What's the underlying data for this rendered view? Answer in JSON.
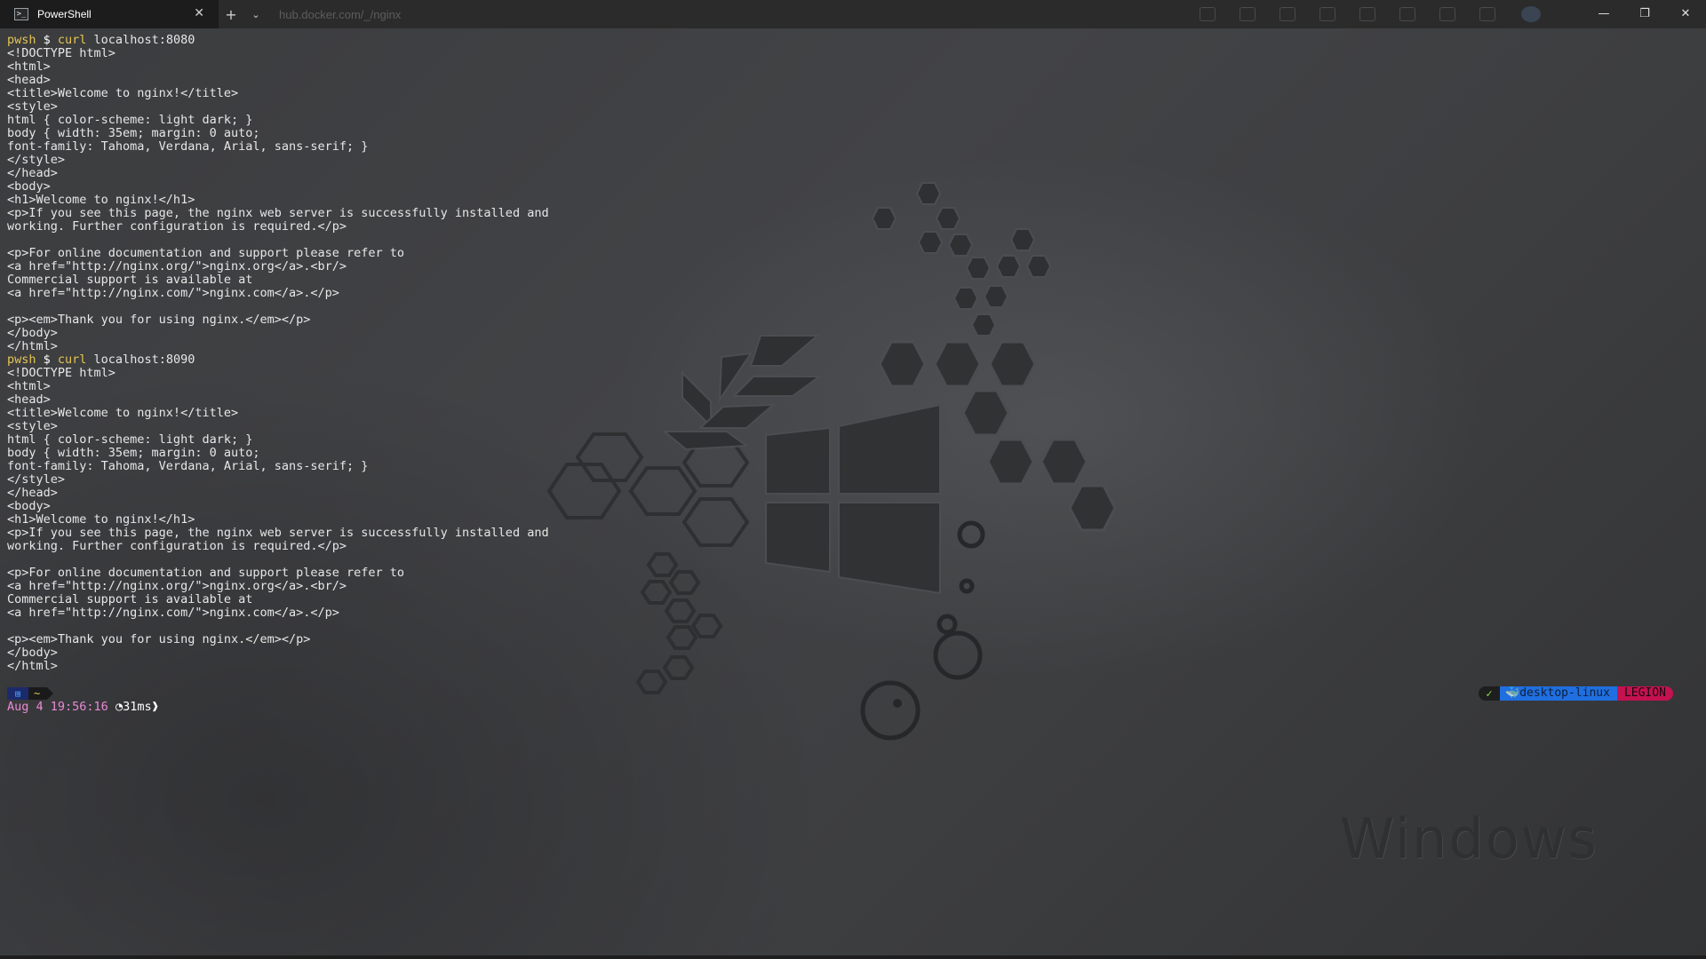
{
  "titlebar": {
    "tab_title": "PowerShell",
    "tab_icon_glyph": ">_",
    "close_glyph": "✕",
    "new_tab_glyph": "+",
    "dropdown_glyph": "⌄",
    "ghost_url": "hub.docker.com/_/nginx",
    "minimize_glyph": "—",
    "maximize_glyph": "❐",
    "window_close_glyph": "✕"
  },
  "terminal": {
    "lines": [
      {
        "type": "prompt",
        "user": "pwsh",
        "dollar": " $ ",
        "cmd": "curl",
        "args": " localhost:8080"
      },
      {
        "type": "text",
        "text": "<!DOCTYPE html>"
      },
      {
        "type": "text",
        "text": "<html>"
      },
      {
        "type": "text",
        "text": "<head>"
      },
      {
        "type": "text",
        "text": "<title>Welcome to nginx!</title>"
      },
      {
        "type": "text",
        "text": "<style>"
      },
      {
        "type": "text",
        "text": "html { color-scheme: light dark; }"
      },
      {
        "type": "text",
        "text": "body { width: 35em; margin: 0 auto;"
      },
      {
        "type": "text",
        "text": "font-family: Tahoma, Verdana, Arial, sans-serif; }"
      },
      {
        "type": "text",
        "text": "</style>"
      },
      {
        "type": "text",
        "text": "</head>"
      },
      {
        "type": "text",
        "text": "<body>"
      },
      {
        "type": "text",
        "text": "<h1>Welcome to nginx!</h1>"
      },
      {
        "type": "text",
        "text": "<p>If you see this page, the nginx web server is successfully installed and"
      },
      {
        "type": "text",
        "text": "working. Further configuration is required.</p>"
      },
      {
        "type": "text",
        "text": ""
      },
      {
        "type": "text",
        "text": "<p>For online documentation and support please refer to"
      },
      {
        "type": "text",
        "text": "<a href=\"http://nginx.org/\">nginx.org</a>.<br/>"
      },
      {
        "type": "text",
        "text": "Commercial support is available at"
      },
      {
        "type": "text",
        "text": "<a href=\"http://nginx.com/\">nginx.com</a>.</p>"
      },
      {
        "type": "text",
        "text": ""
      },
      {
        "type": "text",
        "text": "<p><em>Thank you for using nginx.</em></p>"
      },
      {
        "type": "text",
        "text": "</body>"
      },
      {
        "type": "text",
        "text": "</html>"
      },
      {
        "type": "prompt",
        "user": "pwsh",
        "dollar": " $ ",
        "cmd": "curl",
        "args": " localhost:8090"
      },
      {
        "type": "text",
        "text": "<!DOCTYPE html>"
      },
      {
        "type": "text",
        "text": "<html>"
      },
      {
        "type": "text",
        "text": "<head>"
      },
      {
        "type": "text",
        "text": "<title>Welcome to nginx!</title>"
      },
      {
        "type": "text",
        "text": "<style>"
      },
      {
        "type": "text",
        "text": "html { color-scheme: light dark; }"
      },
      {
        "type": "text",
        "text": "body { width: 35em; margin: 0 auto;"
      },
      {
        "type": "text",
        "text": "font-family: Tahoma, Verdana, Arial, sans-serif; }"
      },
      {
        "type": "text",
        "text": "</style>"
      },
      {
        "type": "text",
        "text": "</head>"
      },
      {
        "type": "text",
        "text": "<body>"
      },
      {
        "type": "text",
        "text": "<h1>Welcome to nginx!</h1>"
      },
      {
        "type": "text",
        "text": "<p>If you see this page, the nginx web server is successfully installed and"
      },
      {
        "type": "text",
        "text": "working. Further configuration is required.</p>"
      },
      {
        "type": "text",
        "text": ""
      },
      {
        "type": "text",
        "text": "<p>For online documentation and support please refer to"
      },
      {
        "type": "text",
        "text": "<a href=\"http://nginx.org/\">nginx.org</a>.<br/>"
      },
      {
        "type": "text",
        "text": "Commercial support is available at"
      },
      {
        "type": "text",
        "text": "<a href=\"http://nginx.com/\">nginx.com</a>.</p>"
      },
      {
        "type": "text",
        "text": ""
      },
      {
        "type": "text",
        "text": "<p><em>Thank you for using nginx.</em></p>"
      },
      {
        "type": "text",
        "text": "</body>"
      },
      {
        "type": "text",
        "text": "</html>"
      }
    ]
  },
  "prompt": {
    "os_icon": "⊞",
    "path": "~",
    "date_time": "Aug 4 19:56:16",
    "exec_icon": "◔",
    "exec_time": "31ms",
    "exec_end": "❱",
    "status_icon": "✓",
    "docker_icon": "🐳",
    "docker_context": "desktop-linux",
    "host": "LEGION"
  },
  "wallpaper": {
    "watermark": "Windows"
  },
  "colors": {
    "prompt_user": "#e6c453",
    "date": "#e88ad6",
    "docker_segment": "#1f6fe0",
    "host_segment": "#c4124f",
    "status_ok": "#8be04c"
  }
}
